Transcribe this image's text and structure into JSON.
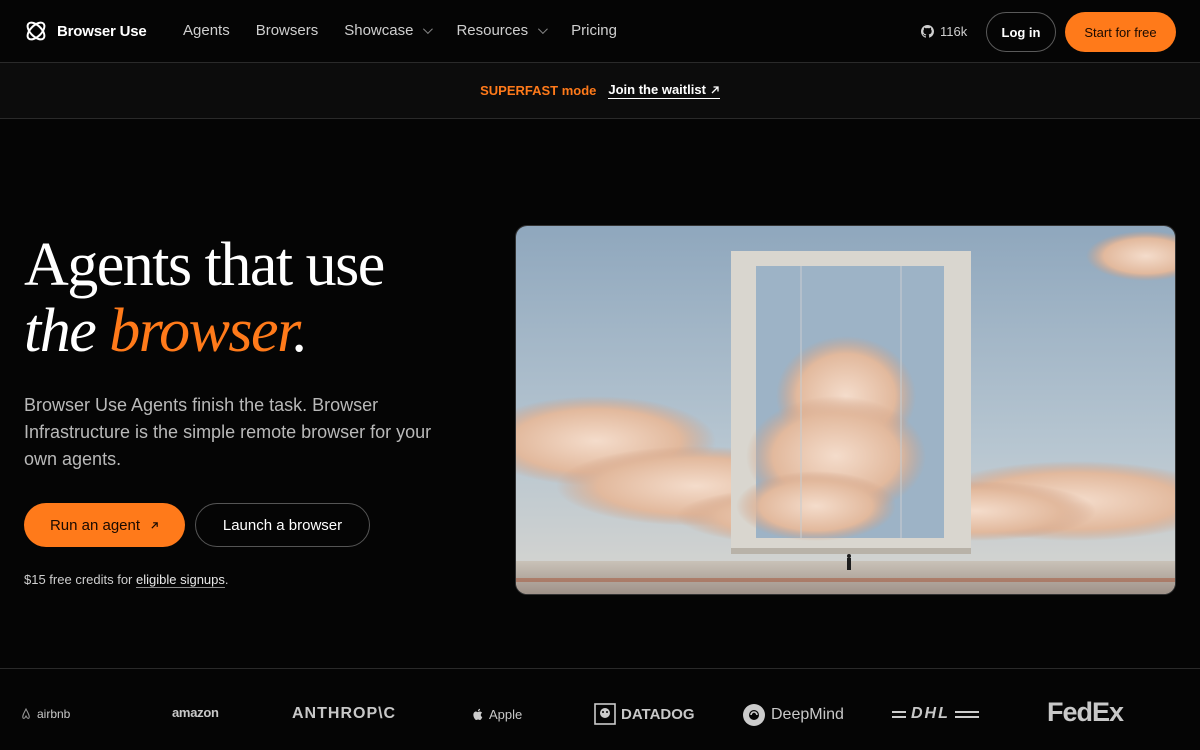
{
  "nav": {
    "brand": "Browser Use",
    "links": [
      {
        "label": "Agents"
      },
      {
        "label": "Browsers"
      },
      {
        "label": "Showcase"
      },
      {
        "label": "Resources"
      },
      {
        "label": "Pricing"
      }
    ],
    "github_stars": "116k",
    "login_label": "Log in",
    "start_label": "Start for free"
  },
  "banner": {
    "mode": "SUPERFAST mode",
    "link": "Join the waitlist"
  },
  "hero": {
    "title_line1": "Agents that use",
    "title_line2_a": "the ",
    "title_line2_accent": "browser",
    "title_line2_b": ".",
    "subtitle": "Browser Use Agents finish the task. Browser Infrastructure is the simple remote browser for your own agents.",
    "run_label": "Run an agent",
    "launch_label": "Launch a browser",
    "credits_text": "$15 free credits for ",
    "credits_link": "eligible signups",
    "credits_end": "."
  },
  "logos": {
    "airbnb": "airbnb",
    "amazon": "amazon",
    "anthropic": "ANTHROP\\C",
    "apple": "Apple",
    "datadog": "DATADOG",
    "deepmind": "DeepMind",
    "dhl": "DHL",
    "fedex": "FedEx"
  },
  "colors": {
    "accent": "#ff7a1a",
    "background": "#050505"
  }
}
